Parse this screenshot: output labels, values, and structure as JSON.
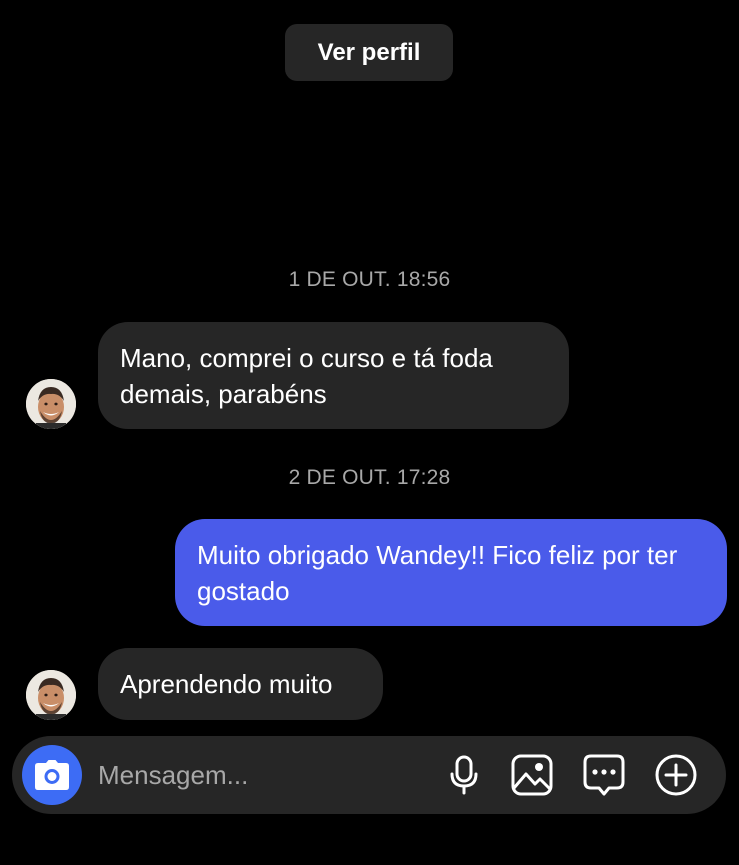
{
  "header": {
    "view_profile_label": "Ver perfil"
  },
  "conversation": {
    "timestamps": [
      "1 DE OUT. 18:56",
      "2 DE OUT. 17:28"
    ],
    "messages": [
      {
        "direction": "incoming",
        "text": "Mano, comprei o curso e tá foda demais, parabéns"
      },
      {
        "direction": "outgoing",
        "text": "Muito obrigado Wandey!! Fico feliz por ter gostado"
      },
      {
        "direction": "incoming",
        "text": "Aprendendo muito"
      }
    ]
  },
  "composer": {
    "placeholder": "Mensagem...",
    "icons": [
      "camera-icon",
      "microphone-icon",
      "image-icon",
      "sticker-icon",
      "plus-icon"
    ]
  },
  "colors": {
    "background": "#000000",
    "incoming_bubble": "#262626",
    "outgoing_bubble": "#4a5bea",
    "camera_button": "#3d6cf5",
    "muted_text": "#a8a8a8"
  }
}
